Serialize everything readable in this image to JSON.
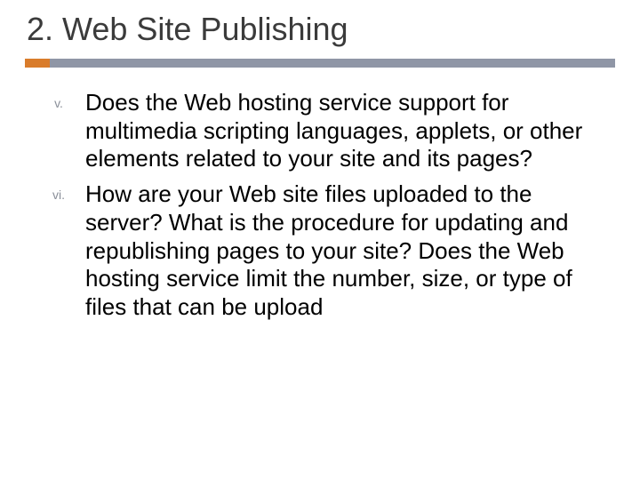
{
  "title": "2. Web Site Publishing",
  "items": [
    {
      "marker": "v.",
      "text": "Does the Web hosting service support for multimedia scripting languages, applets, or other elements related to your site and its pages?"
    },
    {
      "marker": "vi.",
      "text": "How are your  Web site files uploaded to the server? What is the procedure for updating and republishing pages to your site? Does the Web hosting service limit the number, size, or type of files that can be upload"
    }
  ]
}
